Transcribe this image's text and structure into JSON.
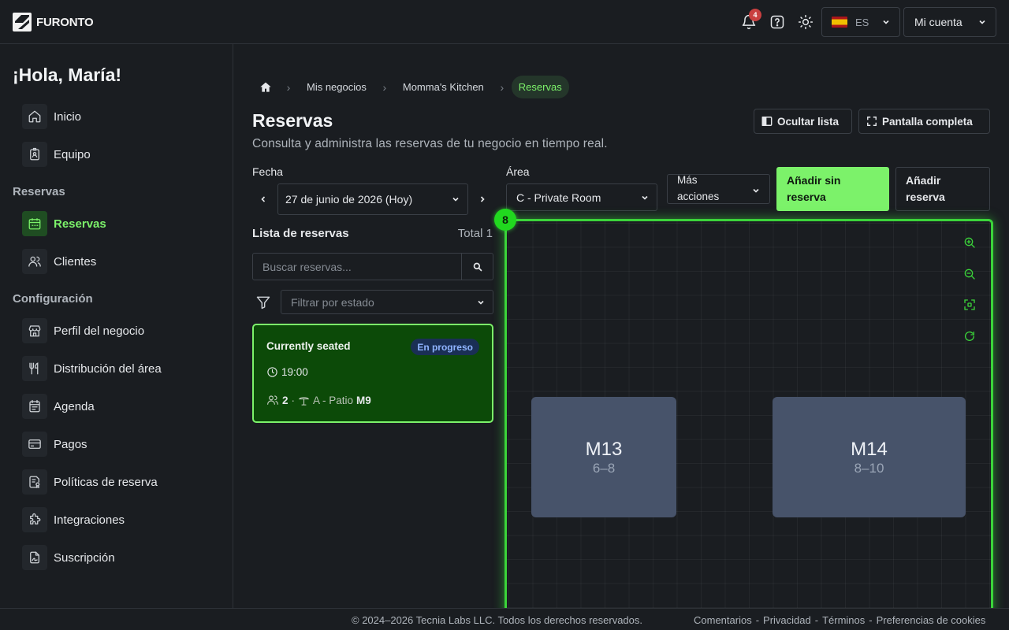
{
  "header": {
    "brand": "FURONTO",
    "notifications_count": "4",
    "language": "ES",
    "account_label": "Mi cuenta"
  },
  "sidebar": {
    "greeting": "¡Hola, María!",
    "items_top": [
      {
        "label": "Inicio",
        "icon": "home-icon"
      },
      {
        "label": "Equipo",
        "icon": "badge-icon"
      }
    ],
    "section_reservas": "Reservas",
    "items_reservas": [
      {
        "label": "Reservas",
        "icon": "calendar-icon",
        "active": true
      },
      {
        "label": "Clientes",
        "icon": "users-icon"
      }
    ],
    "section_config": "Configuración",
    "items_config": [
      {
        "label": "Perfil del negocio",
        "icon": "store-icon"
      },
      {
        "label": "Distribución del área",
        "icon": "utensils-icon"
      },
      {
        "label": "Agenda",
        "icon": "agenda-icon"
      },
      {
        "label": "Pagos",
        "icon": "card-icon"
      },
      {
        "label": "Políticas de reserva",
        "icon": "policy-icon"
      },
      {
        "label": "Integraciones",
        "icon": "puzzle-icon"
      },
      {
        "label": "Suscripción",
        "icon": "subscription-icon"
      }
    ]
  },
  "breadcrumb": [
    "Mis negocios",
    "Momma's Kitchen",
    "Reservas"
  ],
  "page": {
    "title": "Reservas",
    "subtitle": "Consulta y administra las reservas de tu negocio en tiempo real.",
    "hide_list": "Ocultar lista",
    "fullscreen": "Pantalla completa"
  },
  "filters": {
    "date_label": "Fecha",
    "date_value": "27 de junio de 2026 (Hoy)",
    "area_label": "Área",
    "area_value": "C - Private Room",
    "more_actions": "Más acciones",
    "add_walkin": "Añadir sin reserva",
    "add_reservation": "Añadir reserva"
  },
  "list": {
    "title": "Lista de reservas",
    "total": "Total 1",
    "search_placeholder": "Buscar reservas...",
    "filter_placeholder": "Filtrar por estado",
    "reservations": [
      {
        "name": "Currently seated",
        "status": "En progreso",
        "time": "19:00",
        "party": "2",
        "area": "A - Patio",
        "table": "M9"
      }
    ]
  },
  "floor": {
    "marker": "8",
    "tables": [
      {
        "name": "M13",
        "capacity": "6–8"
      },
      {
        "name": "M14",
        "capacity": "8–10"
      }
    ]
  },
  "footer": {
    "copyright": "© 2024–2026 Tecnia Labs LLC. Todos los derechos reservados.",
    "links": [
      "Comentarios",
      "Privacidad",
      "Términos",
      "Preferencias de cookies"
    ]
  },
  "colors": {
    "accent": "#7cf26a",
    "background": "#1a1d21",
    "table_fill": "#47536a",
    "card_fill": "#0c4a08",
    "floor_border": "#3bd43a"
  }
}
